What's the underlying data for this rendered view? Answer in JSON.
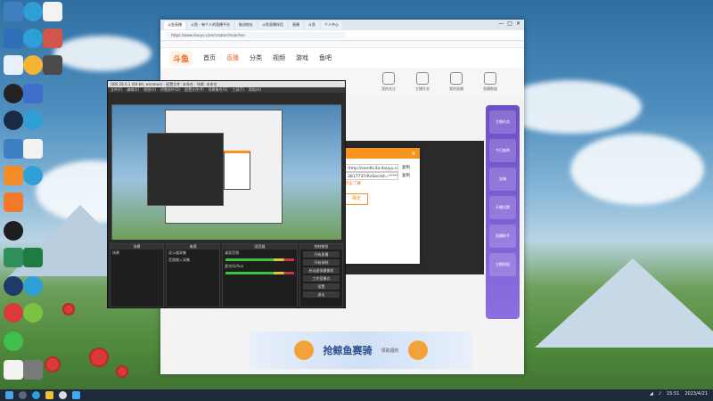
{
  "desktop": {
    "accent_colors": {
      "sky": "#4f8fbf",
      "grass": "#4f8a3c",
      "taskbar": "#1c2a3a"
    }
  },
  "taskbar": {
    "clock_time": "15:51",
    "clock_date": "2023/4/21"
  },
  "browser": {
    "active_tab": "斗鱼直播 - 每个人的直播平台",
    "tabs": [
      "斗鱼直播",
      "斗鱼 - 每个人的直播平台",
      "推流地址",
      "斗鱼直播伴侣",
      "直播",
      "斗鱼",
      "个人中心"
    ],
    "url": "https://www.douyu.com/creator/main/live",
    "window_controls": [
      "—",
      "□",
      "✕"
    ]
  },
  "site": {
    "logo": "斗鱼",
    "nav": [
      "首页",
      "直播",
      "分类",
      "视频",
      "游戏",
      "鱼吧"
    ],
    "nav_active": "直播",
    "icons": [
      "我的关注",
      "主播任务",
      "我的直播",
      "直播数据"
    ]
  },
  "dialog": {
    "close": "×",
    "address_value": "rtmp://sendtc3a.douyu.com/live",
    "copy": "复制",
    "code_value": "3817737rKxSecret=********",
    "link": "点击了解",
    "ok_label": "确定"
  },
  "right_rail": {
    "items": [
      "主播任务",
      "今日盛典",
      "宝箱",
      "开播设置",
      "直播助手",
      "主播周报"
    ]
  },
  "banner": {
    "title": "抢鲸鱼赛骑",
    "subtitle": "领取福利"
  },
  "obs": {
    "title": "OBS 28.0.1 (64-bit, windows) - 配置文件: 未命名 - 场景: 未命名",
    "menu": [
      "文件(F)",
      "编辑(E)",
      "视图(V)",
      "停靠部件(D)",
      "配置文件(P)",
      "场景集合(S)",
      "工具(T)",
      "帮助(H)"
    ],
    "docks": [
      "场景",
      "来源",
      "混音器",
      "转场特效",
      "控制按钮"
    ],
    "scenes": [
      "场景"
    ],
    "sources": [
      "显示器采集",
      "音频输入采集"
    ],
    "mixer": [
      "桌面音频",
      "麦克风/Aux"
    ],
    "controls": [
      "开始直播",
      "开始录制",
      "启动虚拟摄像机",
      "工作室模式",
      "设置",
      "退出"
    ]
  }
}
